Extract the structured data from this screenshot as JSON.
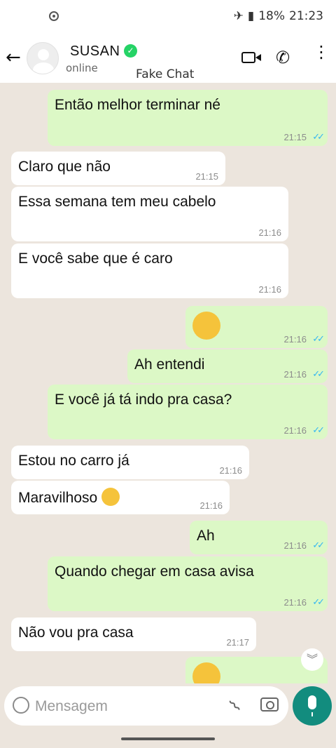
{
  "status_bar": {
    "battery": "18%",
    "time": "21:23",
    "airplane_icon": "airplane-icon",
    "battery_icon": "battery-icon"
  },
  "header": {
    "name": "SUSAN",
    "status": "online",
    "watermark": "Fake Chat"
  },
  "messages": [
    {
      "dir": "out",
      "text": "Então melhor terminar né",
      "time": "21:15",
      "read": "✓✓"
    },
    {
      "dir": "in",
      "text": "Claro que não",
      "time": "21:15"
    },
    {
      "dir": "in",
      "text": "Essa semana tem meu cabelo",
      "time": "21:16"
    },
    {
      "dir": "in",
      "text": "E você sabe que é caro",
      "time": "21:16"
    },
    {
      "dir": "out",
      "text": "",
      "emoji": "flushed-face",
      "time": "21:16",
      "read": "✓✓"
    },
    {
      "dir": "out",
      "text": "Ah entendi",
      "time": "21:16",
      "read": "✓✓"
    },
    {
      "dir": "out",
      "text": "E você já tá indo pra casa?",
      "time": "21:16",
      "read": "✓✓"
    },
    {
      "dir": "in",
      "text": "Estou no carro já",
      "time": "21:16"
    },
    {
      "dir": "in",
      "text": "Maravilhoso",
      "emoji": "heart-eyes-face",
      "time": "21:16"
    },
    {
      "dir": "out",
      "text": "Ah",
      "time": "21:16",
      "read": "✓✓"
    },
    {
      "dir": "out",
      "text": "Quando chegar em casa avisa",
      "time": "21:16",
      "read": "✓✓"
    },
    {
      "dir": "in",
      "text": "Não vou pra casa",
      "time": "21:17"
    },
    {
      "dir": "out",
      "text": "",
      "emoji": "thinking-face"
    }
  ],
  "composer": {
    "placeholder": "Mensagem"
  }
}
